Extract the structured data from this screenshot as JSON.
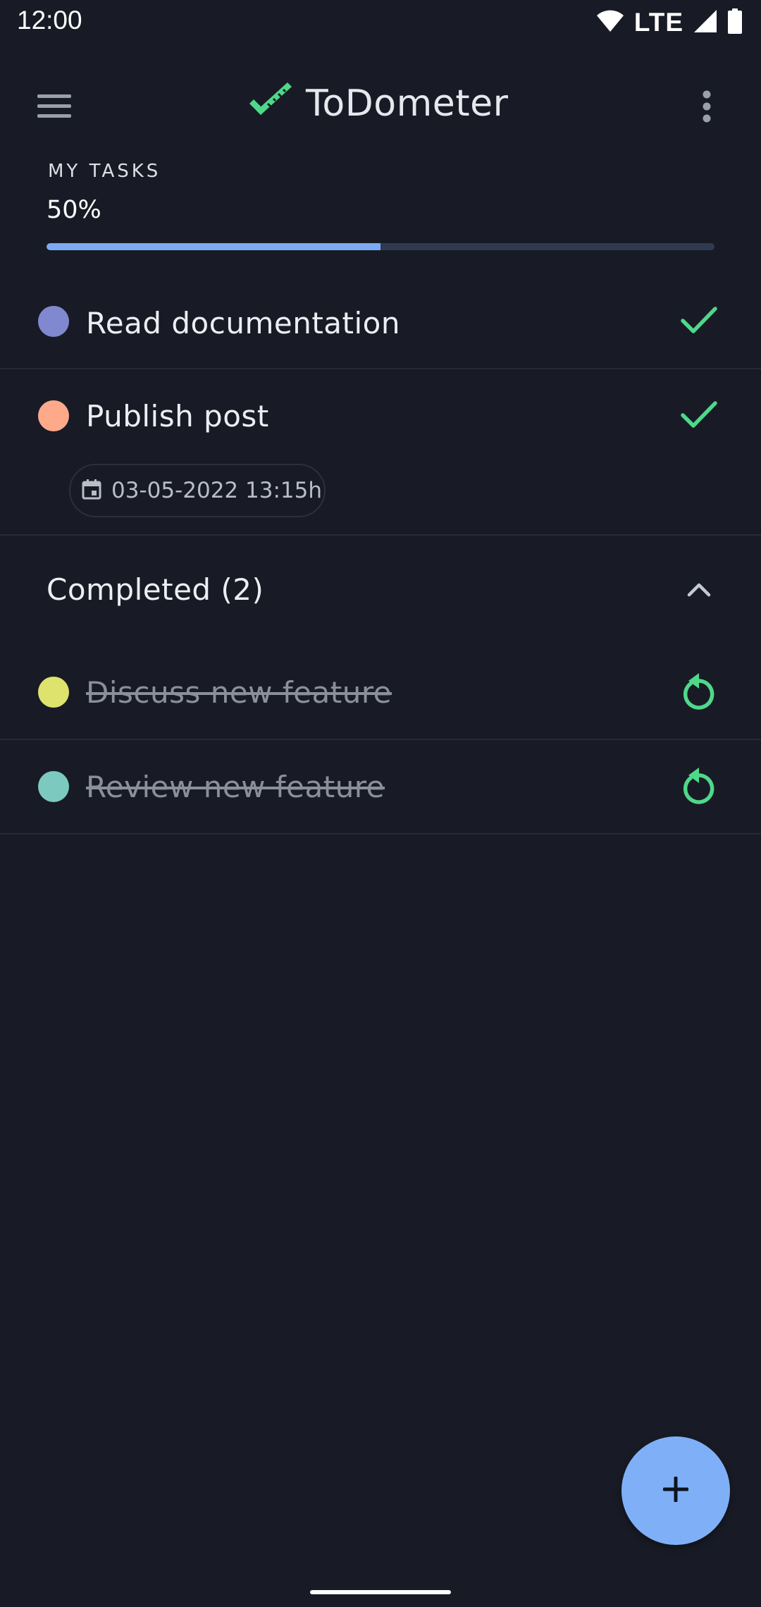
{
  "status_bar": {
    "time": "12:00",
    "network": "LTE",
    "icons": [
      "wifi-icon",
      "signal-icon",
      "battery-icon"
    ]
  },
  "app_bar": {
    "title": "ToDometer",
    "logo_icon": "ruler-check-icon",
    "menu_icon": "hamburger-menu-icon",
    "more_icon": "more-vert-icon"
  },
  "progress": {
    "header": "MY TASKS",
    "label": "50%",
    "value": 0.5
  },
  "tasks": [
    {
      "title": "Read documentation",
      "color": "#8089d0",
      "completed": false,
      "action_icon": "check-icon"
    },
    {
      "title": "Publish post",
      "color": "#ffa98b",
      "completed": false,
      "action_icon": "check-icon",
      "due_date": "03-05-2022 13:15h",
      "due_icon": "calendar-icon"
    }
  ],
  "completed_section": {
    "title": "Completed (2)",
    "toggle_icon": "chevron-up-icon",
    "tasks": [
      {
        "title": "Discuss new feature",
        "color": "#dde36d",
        "completed": true,
        "action_icon": "restore-icon"
      },
      {
        "title": "Review new feature",
        "color": "#7cc9c0",
        "completed": true,
        "action_icon": "restore-icon"
      }
    ]
  },
  "fab": {
    "icon": "plus-icon"
  },
  "colors": {
    "background": "#181b25",
    "accent": "#7eaaf2",
    "check": "#4fd88a",
    "divider": "#262a35"
  }
}
